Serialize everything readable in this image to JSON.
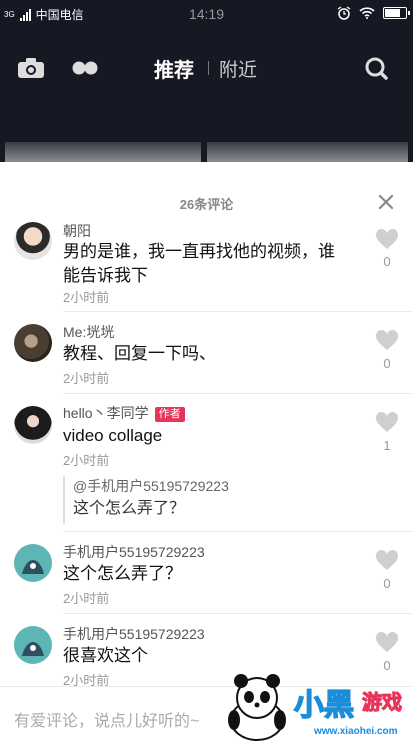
{
  "status_bar": {
    "network": "3G",
    "carrier": "中国电信",
    "time": "14:19"
  },
  "nav": {
    "tabs": [
      {
        "label": "推荐",
        "active": true
      },
      {
        "label": "附近",
        "active": false
      }
    ]
  },
  "comments_sheet": {
    "title": "26条评论",
    "comments": [
      {
        "user": "朝阳",
        "text": "男的是谁，我一直再找他的视频，谁能告诉我下",
        "time": "2小时前",
        "likes": "0"
      },
      {
        "user": "Me:垙垙",
        "text": "教程、回复一下吗、",
        "time": "2小时前",
        "likes": "0"
      },
      {
        "user": "hello丶李同学",
        "badge": "作者",
        "text": "video collage",
        "time": "2小时前",
        "likes": "1",
        "reply": {
          "user": "@手机用户55195729223",
          "text": "这个怎么弄了？"
        }
      },
      {
        "user": "手机用户55195729223",
        "text": "这个怎么弄了？",
        "time": "2小时前",
        "likes": "0"
      },
      {
        "user": "手机用户55195729223",
        "text": "很喜欢这个",
        "time": "2小时前",
        "likes": "0"
      }
    ]
  },
  "input": {
    "placeholder": "有爱评论，说点儿好听的~"
  },
  "watermark": {
    "brand": "小黑",
    "brand2": "游戏",
    "domain": "www.xiaohei.com"
  },
  "colors": {
    "nav_bg": "#161823",
    "badge": "#e8345b",
    "muted": "#999999"
  }
}
